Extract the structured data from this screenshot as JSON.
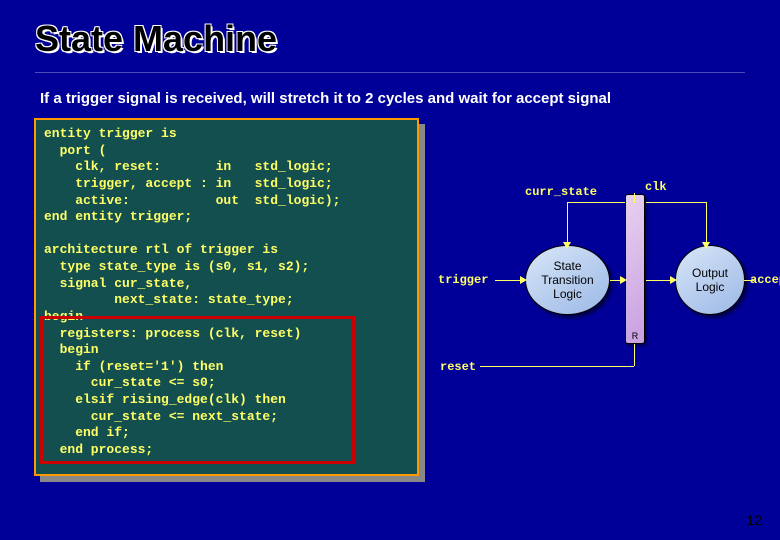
{
  "title": "State Machine",
  "subtitle": "If a trigger signal is received, will stretch it to 2 cycles and wait for accept signal",
  "code": "entity trigger is\n  port (\n    clk, reset:       in   std_logic;\n    trigger, accept : in   std_logic;\n    active:           out  std_logic);\nend entity trigger;\n\narchitecture rtl of trigger is\n  type state_type is (s0, s1, s2);\n  signal cur_state,\n         next_state: state_type;\nbegin\n  registers: process (clk, reset)\n  begin\n    if (reset='1') then\n      cur_state <= s0;\n    elsif rising_edge(clk) then\n      cur_state <= next_state;\n    end if;\n  end process;",
  "diagram": {
    "clk": "clk",
    "curr_state": "curr_state",
    "trigger": "trigger",
    "reset": "reset",
    "accept": "accept",
    "stl": "State\nTransition\nLogic",
    "output": "Output\nLogic",
    "r": "R"
  },
  "page": "12"
}
